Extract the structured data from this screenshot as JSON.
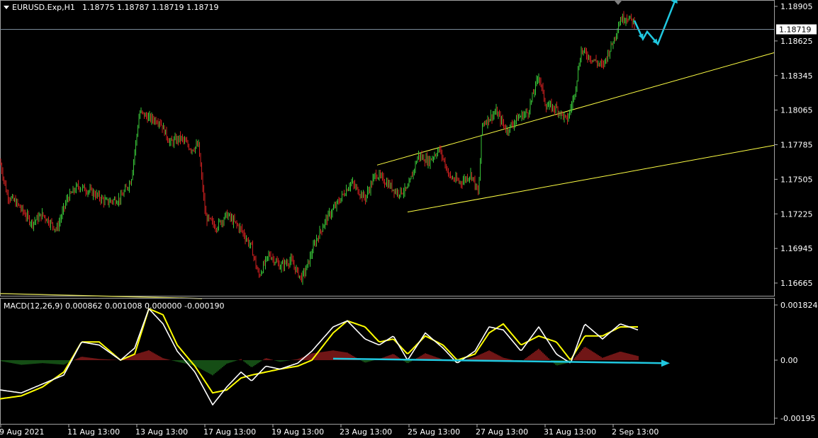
{
  "header": {
    "symbol": "EURUSD.Exp,H1",
    "ohlc": "1.18775 1.18787 1.18719 1.18719",
    "macd_label": "MACD(12,26,9) 0.000862 0.001008 0.000000 -0.000190"
  },
  "colors": {
    "background": "#000000",
    "bull": "#38c438",
    "bear": "#d02020",
    "channel": "#ffff44",
    "arrow": "#20c8e0",
    "macd_main": "#ffffff",
    "macd_signal": "#ffff00",
    "hist_pos": "#a02020",
    "hist_neg": "#1e6e1e",
    "axis": "#b0b0b0"
  },
  "current_price": "1.18719",
  "chart_data": [
    {
      "type": "candlestick",
      "price_ticks": [
        "1.18905",
        "1.18625",
        "1.18345",
        "1.18065",
        "1.17785",
        "1.17505",
        "1.17225",
        "1.16945",
        "1.16665"
      ],
      "ylim": [
        1.1654,
        1.1897
      ],
      "time_ticks": [
        "9 Aug 2021",
        "11 Aug 13:00",
        "13 Aug 13:00",
        "17 Aug 13:00",
        "19 Aug 13:00",
        "23 Aug 13:00",
        "25 Aug 13:00",
        "27 Aug 13:00",
        "31 Aug 13:00",
        "2 Sep 13:00"
      ],
      "close_path": [
        [
          0,
          1.1765
        ],
        [
          10,
          1.1738
        ],
        [
          25,
          1.173
        ],
        [
          45,
          1.1715
        ],
        [
          60,
          1.1722
        ],
        [
          80,
          1.171
        ],
        [
          95,
          1.1735
        ],
        [
          110,
          1.1745
        ],
        [
          130,
          1.174
        ],
        [
          150,
          1.1732
        ],
        [
          170,
          1.1735
        ],
        [
          185,
          1.175
        ],
        [
          197,
          1.1805
        ],
        [
          210,
          1.18
        ],
        [
          225,
          1.1798
        ],
        [
          240,
          1.178
        ],
        [
          255,
          1.1784
        ],
        [
          270,
          1.1775
        ],
        [
          280,
          1.1778
        ],
        [
          290,
          1.172
        ],
        [
          305,
          1.1712
        ],
        [
          320,
          1.1722
        ],
        [
          340,
          1.171
        ],
        [
          355,
          1.1695
        ],
        [
          365,
          1.1672
        ],
        [
          380,
          1.169
        ],
        [
          395,
          1.168
        ],
        [
          410,
          1.1685
        ],
        [
          425,
          1.167
        ],
        [
          432,
          1.1678
        ],
        [
          445,
          1.17
        ],
        [
          460,
          1.1718
        ],
        [
          475,
          1.173
        ],
        [
          495,
          1.1748
        ],
        [
          515,
          1.1735
        ],
        [
          530,
          1.1755
        ],
        [
          545,
          1.1748
        ],
        [
          560,
          1.174
        ],
        [
          575,
          1.1742
        ],
        [
          590,
          1.177
        ],
        [
          605,
          1.1765
        ],
        [
          620,
          1.1775
        ],
        [
          635,
          1.1752
        ],
        [
          650,
          1.1748
        ],
        [
          665,
          1.1755
        ],
        [
          675,
          1.1738
        ],
        [
          680,
          1.1795
        ],
        [
          700,
          1.1805
        ],
        [
          715,
          1.179
        ],
        [
          730,
          1.18
        ],
        [
          745,
          1.1805
        ],
        [
          760,
          1.1835
        ],
        [
          770,
          1.181
        ],
        [
          785,
          1.1808
        ],
        [
          800,
          1.1798
        ],
        [
          810,
          1.1818
        ],
        [
          820,
          1.1855
        ],
        [
          835,
          1.1848
        ],
        [
          850,
          1.1842
        ],
        [
          865,
          1.1862
        ],
        [
          875,
          1.188
        ],
        [
          885,
          1.1882
        ],
        [
          895,
          1.1877
        ]
      ],
      "arrow_path": [
        [
          895,
          1.1879
        ],
        [
          907,
          1.1864
        ],
        [
          913,
          1.187
        ],
        [
          928,
          1.186
        ],
        [
          955,
          1.1899
        ]
      ],
      "channel_upper": [
        [
          532,
          1.1762
        ],
        [
          1092,
          1.1853
        ]
      ],
      "channel_lower": [
        [
          575,
          1.1724
        ],
        [
          1092,
          1.1778
        ]
      ],
      "fade_line": [
        [
          0,
          1.1658
        ],
        [
          285,
          1.1654
        ]
      ]
    },
    {
      "type": "macd",
      "params": "MACD(12,26,9)",
      "value_ticks": [
        "0.001824",
        "0.00",
        "-0.00195"
      ],
      "ylim": [
        -0.00205,
        0.00205
      ],
      "main": [
        [
          0,
          -0.001
        ],
        [
          30,
          -0.0011
        ],
        [
          60,
          -0.0008
        ],
        [
          90,
          -0.0005
        ],
        [
          115,
          0.0006
        ],
        [
          140,
          0.0005
        ],
        [
          170,
          0.0
        ],
        [
          190,
          0.0004
        ],
        [
          210,
          0.0017
        ],
        [
          230,
          0.0012
        ],
        [
          250,
          0.0003
        ],
        [
          275,
          -0.0004
        ],
        [
          300,
          -0.0015
        ],
        [
          320,
          -0.0009
        ],
        [
          340,
          -0.0004
        ],
        [
          355,
          -0.0007
        ],
        [
          375,
          -0.0002
        ],
        [
          395,
          -0.0003
        ],
        [
          420,
          -0.0001
        ],
        [
          440,
          0.0003
        ],
        [
          470,
          0.0011
        ],
        [
          490,
          0.0013
        ],
        [
          515,
          0.0007
        ],
        [
          535,
          0.0005
        ],
        [
          555,
          0.0008
        ],
        [
          575,
          0.0
        ],
        [
          600,
          0.0009
        ],
        [
          625,
          0.0004
        ],
        [
          645,
          -0.0001
        ],
        [
          670,
          0.0003
        ],
        [
          690,
          0.0011
        ],
        [
          710,
          0.001
        ],
        [
          735,
          0.0003
        ],
        [
          760,
          0.0011
        ],
        [
          785,
          0.0002
        ],
        [
          805,
          -0.0001
        ],
        [
          825,
          0.0012
        ],
        [
          850,
          0.0007
        ],
        [
          875,
          0.0012
        ],
        [
          900,
          0.001
        ]
      ],
      "signal": [
        [
          0,
          -0.0013
        ],
        [
          30,
          -0.0012
        ],
        [
          60,
          -0.0009
        ],
        [
          90,
          -0.0004
        ],
        [
          115,
          0.0006
        ],
        [
          140,
          0.0006
        ],
        [
          170,
          0.0
        ],
        [
          190,
          0.0002
        ],
        [
          210,
          0.0017
        ],
        [
          230,
          0.0015
        ],
        [
          250,
          0.0005
        ],
        [
          275,
          -0.0002
        ],
        [
          300,
          -0.0011
        ],
        [
          320,
          -0.001
        ],
        [
          340,
          -0.0006
        ],
        [
          355,
          -0.0005
        ],
        [
          375,
          -0.0004
        ],
        [
          395,
          -0.0003
        ],
        [
          420,
          -0.0002
        ],
        [
          440,
          0.0
        ],
        [
          470,
          0.0009
        ],
        [
          490,
          0.0013
        ],
        [
          515,
          0.0011
        ],
        [
          535,
          0.0006
        ],
        [
          555,
          0.0007
        ],
        [
          575,
          0.0002
        ],
        [
          600,
          0.0008
        ],
        [
          625,
          0.0005
        ],
        [
          645,
          0.0
        ],
        [
          670,
          0.0002
        ],
        [
          690,
          0.0009
        ],
        [
          710,
          0.0012
        ],
        [
          735,
          0.0005
        ],
        [
          760,
          0.0008
        ],
        [
          785,
          0.0006
        ],
        [
          805,
          0.0
        ],
        [
          825,
          0.0008
        ],
        [
          850,
          0.0008
        ],
        [
          875,
          0.0011
        ],
        [
          900,
          0.0011
        ]
      ],
      "arrow_path": [
        [
          470,
          5e-05
        ],
        [
          945,
          -0.0001
        ]
      ]
    }
  ]
}
